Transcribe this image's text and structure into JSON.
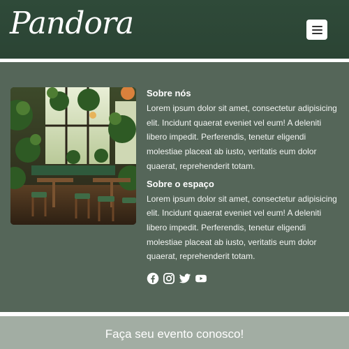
{
  "header": {
    "logo_text": "Pandora",
    "menu_icon": "hamburger-menu-icon"
  },
  "about": {
    "title": "Sobre nós",
    "body": "Lorem ipsum dolor sit amet, consectetur adipisicing elit. Incidunt quaerat eveniet vel eum! A deleniti libero impedit. Perferendis, tenetur eligendi molestiae placeat ab iusto, veritatis eum dolor quaerat, reprehenderit totam."
  },
  "space": {
    "title": "Sobre o espaço",
    "body": "Lorem ipsum dolor sit amet, consectetur adipisicing elit. Incidunt quaerat eveniet vel eum! A deleniti libero impedit. Perferendis, tenetur eligendi molestiae placeat ab iusto, veritatis eum dolor quaerat, reprehenderit totam."
  },
  "socials": [
    "facebook-icon",
    "instagram-icon",
    "twitter-icon",
    "youtube-icon"
  ],
  "cta": {
    "text": "Faça seu evento conosco!"
  },
  "colors": {
    "header_bg": "#2f4a39",
    "main_bg": "#556659",
    "cta_bg": "#a2ada3",
    "text": "#ffffff"
  }
}
